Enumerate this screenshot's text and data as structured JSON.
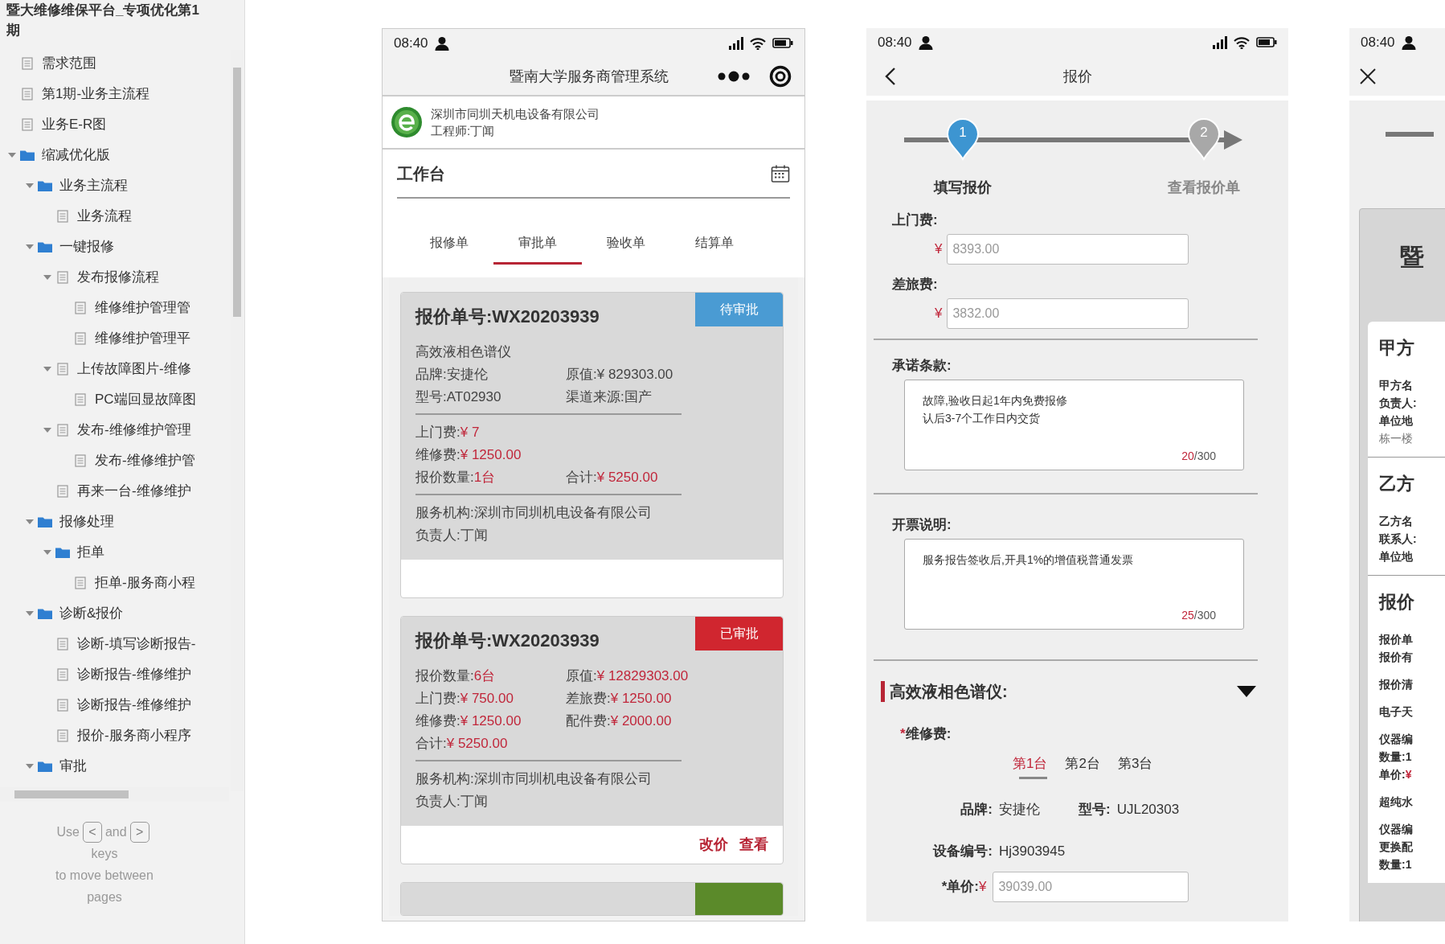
{
  "sidebar": {
    "title": "暨大维修维保平台_专项优化第1期",
    "tree": [
      {
        "label": "需求范围",
        "kind": "page"
      },
      {
        "label": "第1期-业务主流程",
        "kind": "page"
      },
      {
        "label": "业务E-R图",
        "kind": "page"
      },
      {
        "label": "缩减优化版",
        "kind": "folder",
        "expanded": true,
        "children": [
          {
            "label": "业务主流程",
            "kind": "folder",
            "expanded": true,
            "children": [
              {
                "label": "业务流程",
                "kind": "page"
              }
            ]
          },
          {
            "label": "一键报修",
            "kind": "folder",
            "expanded": true,
            "children": [
              {
                "label": "发布报修流程",
                "kind": "page",
                "expanded": true,
                "children": [
                  {
                    "label": "维修维护管理管",
                    "kind": "page"
                  },
                  {
                    "label": "维修维护管理平",
                    "kind": "page"
                  }
                ]
              },
              {
                "label": "上传故障图片-维修",
                "kind": "page",
                "expanded": true,
                "children": [
                  {
                    "label": "PC端回显故障图",
                    "kind": "page"
                  }
                ]
              },
              {
                "label": "发布-维修维护管理",
                "kind": "page",
                "expanded": true,
                "children": [
                  {
                    "label": "发布-维修维护管",
                    "kind": "page"
                  }
                ]
              },
              {
                "label": "再来一台-维修维护",
                "kind": "page"
              }
            ]
          },
          {
            "label": "报修处理",
            "kind": "folder",
            "expanded": true,
            "children": [
              {
                "label": "拒单",
                "kind": "folder",
                "expanded": true,
                "children": [
                  {
                    "label": "拒单-服务商小程",
                    "kind": "page"
                  }
                ]
              }
            ]
          },
          {
            "label": "诊断&报价",
            "kind": "folder",
            "expanded": true,
            "children": [
              {
                "label": "诊断-填写诊断报告-",
                "kind": "page"
              },
              {
                "label": "诊断报告-维修维护",
                "kind": "page"
              },
              {
                "label": "诊断报告-维修维护",
                "kind": "page"
              },
              {
                "label": "报价-服务商小程序",
                "kind": "page"
              }
            ]
          },
          {
            "label": "审批",
            "kind": "folder",
            "expanded": true
          }
        ]
      }
    ],
    "hint": {
      "lead": "Use",
      "keys": [
        "<",
        ">"
      ],
      "joiner": "and",
      "tail": "keys",
      "note": "to move between pages"
    }
  },
  "workbench_phone": {
    "status_bar": {
      "time": "08:40"
    },
    "header": {
      "title": "暨南大学服务商管理系统"
    },
    "company": {
      "name": "深圳市同圳天机电设备有限公司",
      "engineer": "工程师:丁闻"
    },
    "section_title": "工作台",
    "tabs": [
      {
        "label": "报修单",
        "selected": false
      },
      {
        "label": "审批单",
        "selected": true
      },
      {
        "label": "验收单",
        "selected": false
      },
      {
        "label": "结算单",
        "selected": false
      }
    ],
    "cards": [
      {
        "title": "报价单号:WX20203939",
        "status": "待审批",
        "color": "#4a9bd3",
        "sections": [
          [
            [
              {
                "label": "高效液相色谱仪"
              }
            ],
            [
              {
                "label": "品牌:",
                "value": "安捷伦",
                "highlight": false
              },
              {
                "label": "原值:",
                "value": "¥ 829303.00",
                "highlight": false
              }
            ],
            [
              {
                "label": "型号:",
                "value": "AT02930",
                "highlight": false
              },
              {
                "label": "渠道来源:",
                "value": "国产",
                "highlight": false
              }
            ]
          ],
          [
            [
              {
                "label": "上门费:",
                "value": "¥ 7",
                "highlight": true
              }
            ],
            [
              {
                "label": "维修费:",
                "value": "¥ 1250.00",
                "highlight": true
              }
            ],
            [
              {
                "label": "报价数量:",
                "value": "1台",
                "highlight": true
              },
              {
                "label": "合计:",
                "value": "¥ 5250.00",
                "highlight": true
              }
            ]
          ],
          [
            [
              {
                "label": "服务机构:深圳市同圳机电设备有限公司"
              }
            ],
            [
              {
                "label": "负责人:丁闻"
              }
            ]
          ]
        ]
      },
      {
        "title": "报价单号:WX20203939",
        "status": "已审批",
        "color": "#d0262f",
        "sections": [
          [
            [
              {
                "label": "报价数量:",
                "value": "6台",
                "highlight": true
              },
              {
                "label": "原值:",
                "value": "¥ 12829303.00",
                "highlight": true
              }
            ],
            [
              {
                "label": "上门费:",
                "value": "¥ 750.00",
                "highlight": true
              },
              {
                "label": "差旅费:",
                "value": "¥ 1250.00",
                "highlight": true
              }
            ],
            [
              {
                "label": "维修费:",
                "value": "¥ 1250.00",
                "highlight": true
              },
              {
                "label": "配件费:",
                "value": "¥ 2000.00",
                "highlight": true
              }
            ],
            [
              {
                "label": "合计:",
                "value": "¥ 5250.00",
                "highlight": true
              }
            ]
          ],
          [
            [
              {
                "label": "服务机构:深圳市同圳机电设备有限公司"
              }
            ],
            [
              {
                "label": "负责人:丁闻"
              }
            ]
          ]
        ],
        "actions": [
          "改价",
          "查看"
        ]
      },
      {
        "color": "#5b8a2a"
      }
    ]
  },
  "quote_phone": {
    "status_bar": {
      "time": "08:40"
    },
    "header": {
      "title": "报价"
    },
    "steps": [
      {
        "number": "1",
        "label": "填写报价",
        "selected": true
      },
      {
        "number": "2",
        "label": "查看报价单",
        "selected": false
      }
    ],
    "fees": [
      {
        "label": "上门费:",
        "currency": "¥",
        "placeholder": "8393.00"
      },
      {
        "label": "差旅费:",
        "currency": "¥",
        "placeholder": "3832.00"
      }
    ],
    "notes": [
      {
        "label": "承诺条款:",
        "lines": [
          "故障,验收日起1年内免费报修",
          "认后3-7个工作日内交货"
        ],
        "count": "20",
        "limit": "/300"
      },
      {
        "label": "开票说明:",
        "lines": [
          "服务报告签收后,开具1%的增值税普通发票"
        ],
        "count": "25",
        "limit": "/300"
      }
    ],
    "device": {
      "title": "高效液相色谱仪:",
      "expanded": true,
      "mark": "*",
      "fee_label": "维修费:",
      "units": [
        {
          "label": "第1台",
          "selected": true
        },
        {
          "label": "第2台",
          "selected": false
        },
        {
          "label": "第3台",
          "selected": false
        }
      ],
      "fields": [
        {
          "label": "品牌:",
          "value": "安捷伦"
        },
        {
          "label": "型号:",
          "value": "UJL20303"
        }
      ],
      "serial": {
        "label": "设备编号:",
        "value": "Hj3903945"
      },
      "price": {
        "label": "*单价:",
        "currency": "¥",
        "placeholder": "39039.00"
      }
    }
  },
  "preview_phone": {
    "status_bar": {
      "time": "08:40"
    },
    "doc_title": "暨",
    "sections": [
      {
        "title": "甲方",
        "groups": [
          [
            {
              "text": "甲方名",
              "strong": true
            },
            {
              "text": "负责人:",
              "strong": true
            },
            {
              "text": "单位地",
              "strong": true
            },
            {
              "text": "栋一楼",
              "strong": false
            }
          ]
        ]
      },
      {
        "title": "乙方",
        "groups": [
          [
            {
              "text": "乙方名",
              "strong": true
            },
            {
              "text": "联系人:",
              "strong": true
            },
            {
              "text": "单位地",
              "strong": true
            }
          ]
        ]
      },
      {
        "title": "报价",
        "groups": [
          [
            {
              "text": "报价单",
              "strong": true
            },
            {
              "text": "报价有",
              "strong": true
            }
          ],
          [
            {
              "text": "报价清",
              "strong": true
            }
          ],
          [
            {
              "text": "电子天",
              "strong": true
            }
          ],
          [
            {
              "text": "仪器编",
              "strong": true
            },
            {
              "text": "数量:1",
              "strong": true
            },
            {
              "text": "单价:",
              "strong": true,
              "accent": "¥"
            }
          ],
          [
            {
              "text": "超纯水",
              "strong": true
            }
          ],
          [
            {
              "text": "仪器编",
              "strong": true
            },
            {
              "text": "更换配",
              "strong": true
            },
            {
              "text": "数量:1",
              "strong": true
            }
          ]
        ]
      }
    ]
  }
}
